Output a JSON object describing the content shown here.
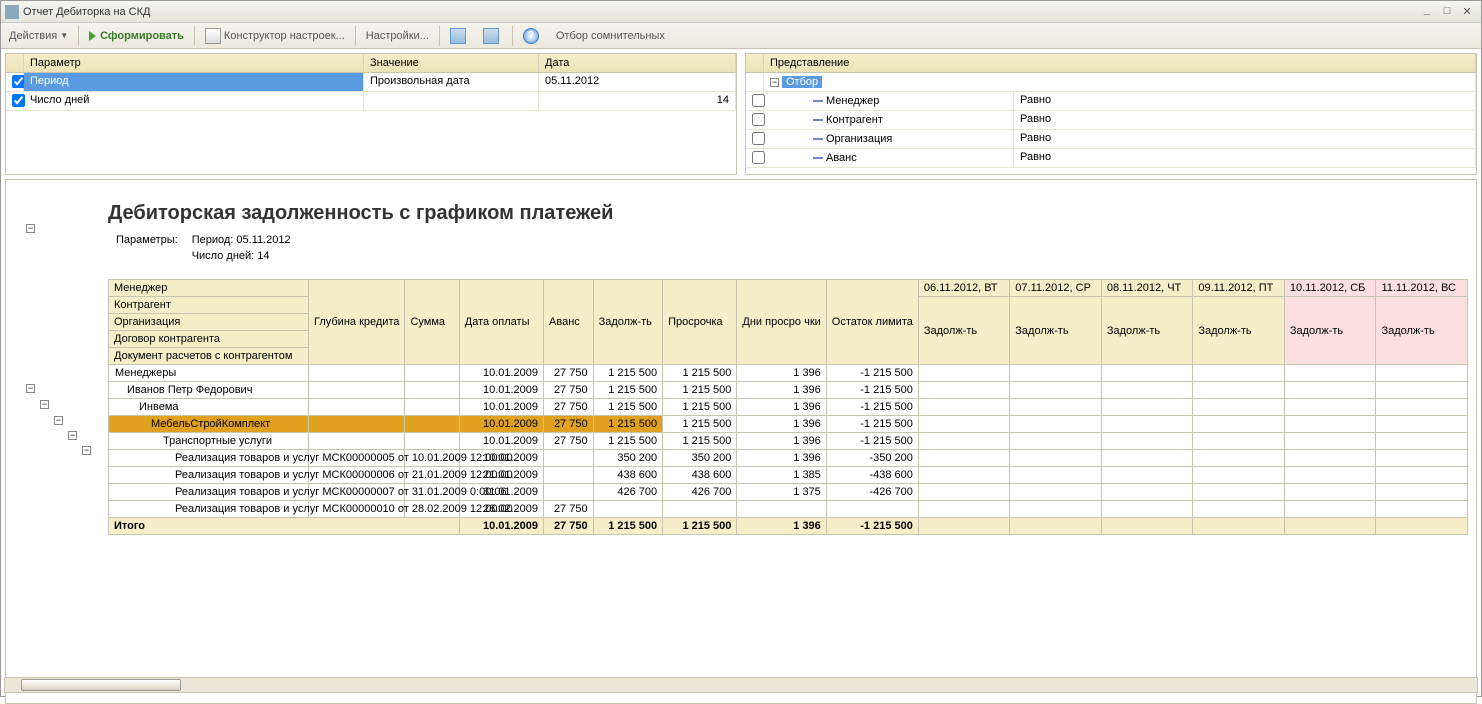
{
  "window": {
    "title": "Отчет  Дебиторка на СКД"
  },
  "toolbar": {
    "actions": "Действия",
    "form": "Сформировать",
    "constructor": "Конструктор настроек...",
    "settings": "Настройки...",
    "filter": "Отбор сомнительных"
  },
  "paramPanel": {
    "hdr_param": "Параметр",
    "hdr_value": "Значение",
    "hdr_date": "Дата",
    "rows": [
      {
        "checked": true,
        "param": "Период",
        "value": "Произвольная дата",
        "date": "05.11.2012",
        "selected": true
      },
      {
        "checked": true,
        "param": "Число дней",
        "value": "",
        "date": "14"
      }
    ]
  },
  "filterPanel": {
    "hdr": "Представление",
    "root": "Отбор",
    "rows": [
      {
        "label": "Менеджер",
        "cond": "Равно"
      },
      {
        "label": "Контрагент",
        "cond": "Равно"
      },
      {
        "label": "Организация",
        "cond": "Равно"
      },
      {
        "label": "Аванс",
        "cond": "Равно"
      }
    ]
  },
  "report": {
    "title": "Дебиторская задолженность с графиком платежей",
    "params_label": "Параметры:",
    "param_period": "Период: 05.11.2012",
    "param_days": "Число дней: 14",
    "headers": {
      "manager": "Менеджер",
      "contragent": "Контрагент",
      "org": "Организация",
      "contract": "Договор контрагента",
      "docrasch": "Документ расчетов с контрагентом",
      "glubina": "Глубина кредита",
      "summa": "Сумма",
      "dataopl": "Дата оплаты",
      "avans": "Аванс",
      "zadolzh": "Задолж-ть",
      "prosrochka": "Просрочка",
      "dniprosr": "Дни просро чки",
      "ostatok": "Остаток лимита",
      "dates": [
        "06.11.2012, ВТ",
        "07.11.2012, СР",
        "08.11.2012, ЧТ",
        "09.11.2012, ПТ",
        "10.11.2012, СБ",
        "11.11.2012, ВС"
      ]
    },
    "rows": [
      {
        "level": 0,
        "label": "Менеджеры",
        "dataopl": "10.01.2009",
        "avans": "27 750",
        "zadolzh": "1 215 500",
        "prosrochka": "1 215 500",
        "dni": "1 396",
        "ostatok": "-1 215 500"
      },
      {
        "level": 1,
        "label": "Иванов Петр Федорович",
        "dataopl": "10.01.2009",
        "avans": "27 750",
        "zadolzh": "1 215 500",
        "prosrochka": "1 215 500",
        "dni": "1 396",
        "ostatok": "-1 215 500"
      },
      {
        "level": 2,
        "label": "Инвема",
        "dataopl": "10.01.2009",
        "avans": "27 750",
        "zadolzh": "1 215 500",
        "prosrochka": "1 215 500",
        "dni": "1 396",
        "ostatok": "-1 215 500"
      },
      {
        "level": 3,
        "label": "МебельСтройКомплект",
        "dataopl": "10.01.2009",
        "avans": "27 750",
        "zadolzh": "1 215 500",
        "prosrochka": "1 215 500",
        "dni": "1 396",
        "ostatok": "-1 215 500",
        "hl": true
      },
      {
        "level": 4,
        "label": "Транспортные услуги",
        "dataopl": "10.01.2009",
        "avans": "27 750",
        "zadolzh": "1 215 500",
        "prosrochka": "1 215 500",
        "dni": "1 396",
        "ostatok": "-1 215 500"
      },
      {
        "level": 5,
        "label": "Реализация товаров и услуг МСК00000005 от 10.01.2009 12:00:00",
        "dataopl": "10.01.2009",
        "avans": "",
        "zadolzh": "350 200",
        "prosrochka": "350 200",
        "dni": "1 396",
        "ostatok": "-350 200"
      },
      {
        "level": 5,
        "label": "Реализация товаров и услуг МСК00000006 от 21.01.2009 12:00:00",
        "dataopl": "21.01.2009",
        "avans": "",
        "zadolzh": "438 600",
        "prosrochka": "438 600",
        "dni": "1 385",
        "ostatok": "-438 600"
      },
      {
        "level": 5,
        "label": "Реализация товаров и услуг МСК00000007 от 31.01.2009 0:00:06",
        "dataopl": "31.01.2009",
        "avans": "",
        "zadolzh": "426 700",
        "prosrochka": "426 700",
        "dni": "1 375",
        "ostatok": "-426 700"
      },
      {
        "level": 5,
        "label": "Реализация товаров и услуг МСК00000010 от 28.02.2009 12:00:00",
        "dataopl": "28.02.2009",
        "avans": "27 750",
        "zadolzh": "",
        "prosrochka": "",
        "dni": "",
        "ostatok": ""
      }
    ],
    "footer": {
      "label": "Итого",
      "dataopl": "10.01.2009",
      "avans": "27 750",
      "zadolzh": "1 215 500",
      "prosrochka": "1 215 500",
      "dni": "1 396",
      "ostatok": "-1 215 500"
    }
  }
}
